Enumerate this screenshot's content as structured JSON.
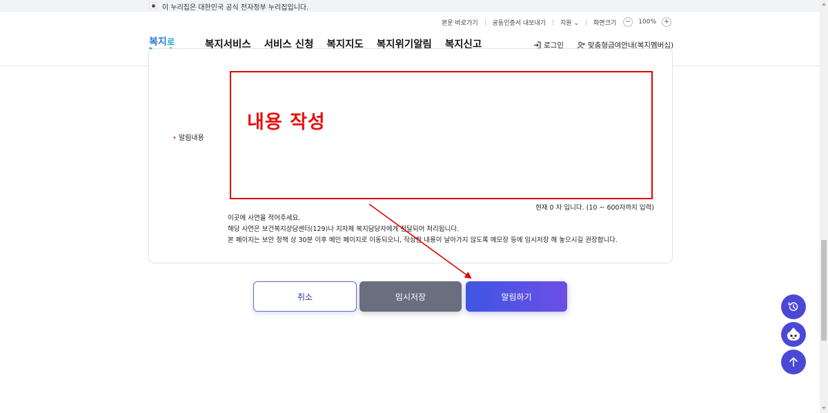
{
  "gov_bar": {
    "text": "이 누리집은 대한민국 공식 전자정부 누리집입니다."
  },
  "util_menu": {
    "skip_link": "본문 바로가기",
    "cert_export": "공동인증서 내보내기",
    "support": "지원",
    "screen_size": "화면크기",
    "zoom_minus": "−",
    "zoom_value": "100%",
    "zoom_plus": "+"
  },
  "logo": {
    "text": "복지로"
  },
  "gnb": {
    "items": [
      "복지서비스",
      "서비스 신청",
      "복지지도",
      "복지위기알림",
      "복지신고"
    ]
  },
  "header_actions": {
    "login": "로그인",
    "custom_guide": "맞춤형급여안내(복지멤버십)"
  },
  "form": {
    "required_mark": "•",
    "field_label": "알림내용",
    "annotation": "내용 작성",
    "counter": "현재 0 자 입니다. (10 ~ 600자까지 입력)",
    "notes": [
      "이곳에 사연을 적어주세요.",
      "해당 사연은 보건복지상담센터(129)나 지자체 복지담당자에게 전달되어 처리됩니다.",
      "본 페이지는 보안 정책 상 30분 이후 메인 페이지로 이동되오니, 작성한 내용이 날아가지 않도록 메모장 등에 임시저장 해 놓으시길 권장합니다."
    ]
  },
  "buttons": {
    "cancel": "취소",
    "temp_save": "임시저장",
    "submit": "알림하기"
  },
  "colors": {
    "accent": "#4b48d6",
    "annotation_red": "#e00000",
    "temp_button": "#6b6e7f"
  },
  "float_icons": [
    "history-icon",
    "chatbot-icon",
    "arrow-up-icon"
  ]
}
